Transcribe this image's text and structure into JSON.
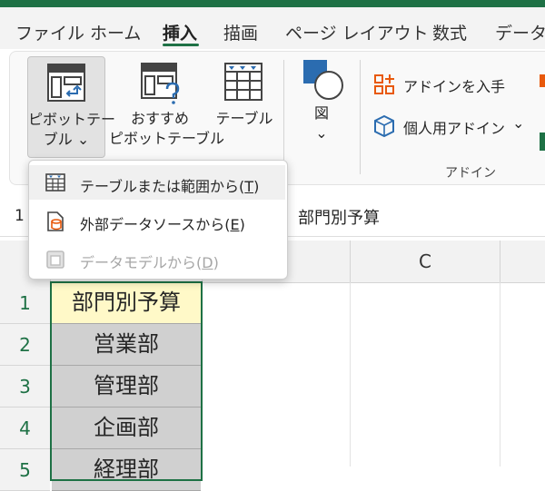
{
  "ribbon_tabs": [
    "ファイル",
    "ホーム",
    "挿入",
    "描画",
    "ページ レイアウト",
    "数式",
    "データ"
  ],
  "active_tab": "挿入",
  "ribbon": {
    "pivot_table": {
      "line1": "ピボットテー",
      "line2": "ブル ⌄"
    },
    "recommended_pivot": {
      "line1": "おすすめ",
      "line2": "ピボットテーブル"
    },
    "table": {
      "label": "テーブル"
    },
    "illustrations": {
      "label": "図",
      "chevron": "⌄"
    },
    "get_addins": {
      "label": "アドインを入手"
    },
    "my_addins": {
      "label": "個人用アドイン",
      "chevron": "⌄"
    },
    "addins_group_label": "アドイン"
  },
  "dropdown": {
    "items": [
      {
        "label": "テーブルまたは範囲から(",
        "key": "T",
        "suffix": ")",
        "icon": "table-range-icon"
      },
      {
        "label": "外部データソースから(",
        "key": "E",
        "suffix": ")",
        "icon": "external-data-icon"
      },
      {
        "label": "データモデルから(",
        "key": "D",
        "suffix": ")",
        "icon": "data-model-icon"
      }
    ]
  },
  "formula_bar": {
    "name_box": "1",
    "value": "部門別予算"
  },
  "columns": [
    "C"
  ],
  "rows": [
    {
      "num": "1",
      "value": "部門別予算"
    },
    {
      "num": "2",
      "value": "営業部"
    },
    {
      "num": "3",
      "value": "管理部"
    },
    {
      "num": "4",
      "value": "企画部"
    },
    {
      "num": "5",
      "value": "経理部"
    }
  ],
  "colors": {
    "accent": "#1e7145",
    "header_fill": "#fff9c8",
    "selection_fill": "#d0d0d0",
    "addin_orange": "#e8590c",
    "addin_blue": "#2b6cb0"
  }
}
